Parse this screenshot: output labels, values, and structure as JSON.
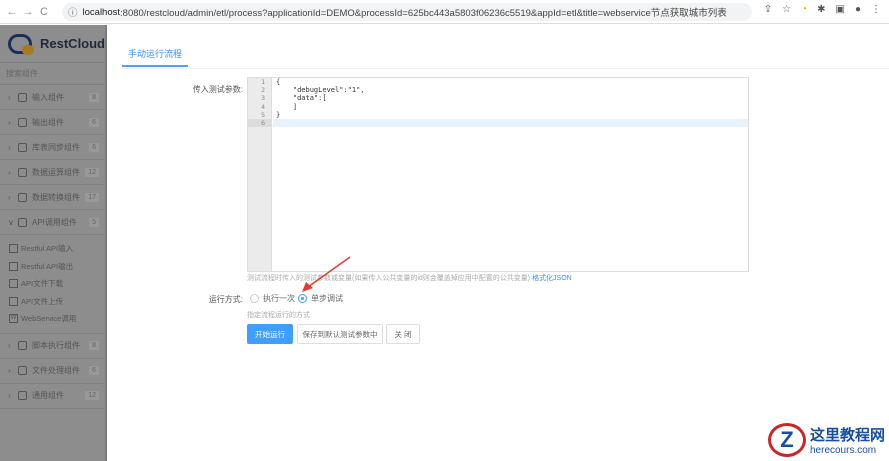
{
  "browser": {
    "url_host": "localhost",
    "url_rest": ":8080/restcloud/admin/etl/process?applicationId=DEMO&processId=625bc443a5803f06236c5519&appId=etl&title=webservice节点获取城市列表"
  },
  "sidebar": {
    "brand": "RestCloud",
    "search": "搜索组件",
    "groups_top": [
      {
        "label": "输入组件",
        "count": "8"
      },
      {
        "label": "输出组件",
        "count": "6"
      },
      {
        "label": "库表同步组件",
        "count": "6"
      },
      {
        "label": "数据运算组件",
        "count": "12"
      },
      {
        "label": "数据转换组件",
        "count": "17"
      },
      {
        "label": "API调用组件",
        "count": "5"
      }
    ],
    "sub_items": [
      {
        "label": "Restful API输入"
      },
      {
        "label": "Restful API输出"
      },
      {
        "label": "API文件下载"
      },
      {
        "label": "API文件上传"
      },
      {
        "label": "WebService调用"
      }
    ],
    "groups_bottom": [
      {
        "label": "脚本执行组件",
        "count": "8"
      },
      {
        "label": "文件处理组件",
        "count": "6"
      },
      {
        "label": "通用组件",
        "count": "12"
      }
    ]
  },
  "main": {
    "tab": "手动运行流程",
    "param_label": "传入测试参数:",
    "editor": {
      "line_numbers": [
        "1",
        "2",
        "3",
        "4",
        "5",
        "6"
      ],
      "lines": [
        "{",
        "    \"debugLevel\":\"1\",",
        "    \"data\":[",
        "    ]",
        "}",
        ""
      ]
    },
    "param_hint": "测试流程时传入的测试参数或变量(如果传入公共变量的id则会覆盖掉应用中配置的公共变量)",
    "format_link": "格式化JSON",
    "run_mode_label": "运行方式:",
    "run_options": [
      {
        "label": "执行一次",
        "checked": false
      },
      {
        "label": "单步调试",
        "checked": true
      }
    ],
    "run_mode_hint": "指定流程运行的方式",
    "buttons": {
      "start": "开始运行",
      "save": "保存到默认测试参数中",
      "close": "关 闭"
    }
  },
  "watermark": {
    "title": "这里教程网",
    "sub": "herecours.com"
  },
  "colors": {
    "accent": "#409eff",
    "arrow": "#e53935"
  }
}
